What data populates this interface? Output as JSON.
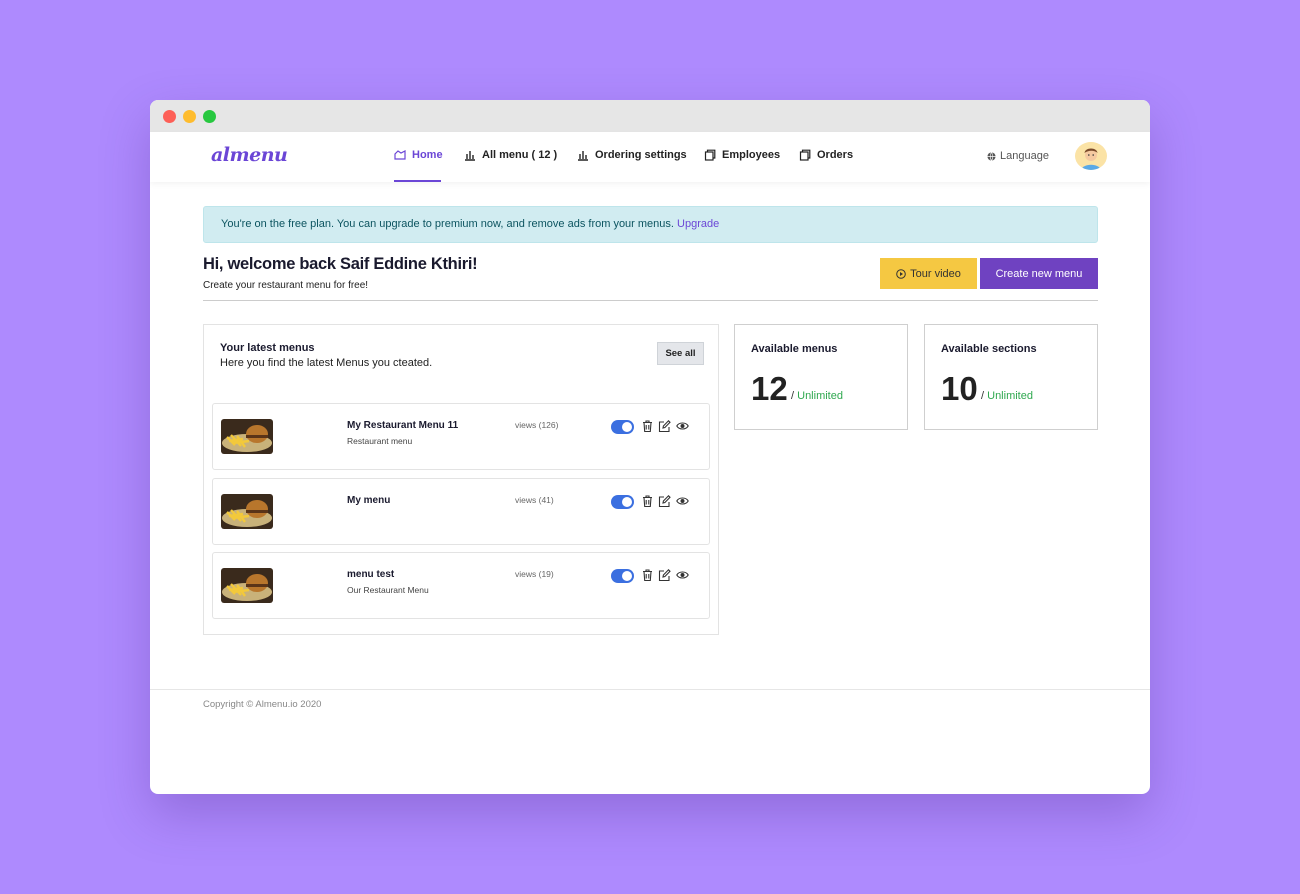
{
  "nav": {
    "logo": "almenu",
    "items": [
      {
        "label": "Home",
        "icon": "home-icon"
      },
      {
        "label": "All menu ( 12 )",
        "icon": "bar-chart-icon"
      },
      {
        "label": "Ordering settings",
        "icon": "bar-chart-icon"
      },
      {
        "label": "Employees",
        "icon": "copy-icon"
      },
      {
        "label": "Orders",
        "icon": "copy-icon"
      }
    ],
    "language": "Language"
  },
  "alert": {
    "text": "You're on the free plan. You can upgrade to premium now, and remove ads from your menus. ",
    "link": "Upgrade"
  },
  "welcome": {
    "title": "Hi, welcome back Saif Eddine Kthiri!",
    "subtitle": "Create your restaurant menu for free!"
  },
  "actions": {
    "tour_video": "Tour video",
    "create_menu": "Create new menu"
  },
  "latest_menus": {
    "title": "Your latest menus",
    "subtitle": "Here you find the latest Menus you cteated.",
    "see_all": "See all",
    "rows": [
      {
        "name": "My Restaurant Menu 11",
        "description": "Restaurant menu",
        "views": "views (126)",
        "enabled": true
      },
      {
        "name": "My menu",
        "description": "",
        "views": "views (41)",
        "enabled": true
      },
      {
        "name": "menu test",
        "description": "Our Restaurant Menu",
        "views": "views (19)",
        "enabled": true
      }
    ]
  },
  "stats": [
    {
      "label": "Available menus",
      "value": "12",
      "limit": "Unlimited"
    },
    {
      "label": "Available sections",
      "value": "10",
      "limit": "Unlimited"
    }
  ],
  "footer": "Copyright © Almenu.io 2020",
  "colors": {
    "background": "#ae8afe",
    "accent": "#6f42c1",
    "tour_button": "#f5c842",
    "toggle_on": "#3b6fe0",
    "unlimited": "#2fa84f",
    "alert_bg": "#d1ecf1"
  }
}
